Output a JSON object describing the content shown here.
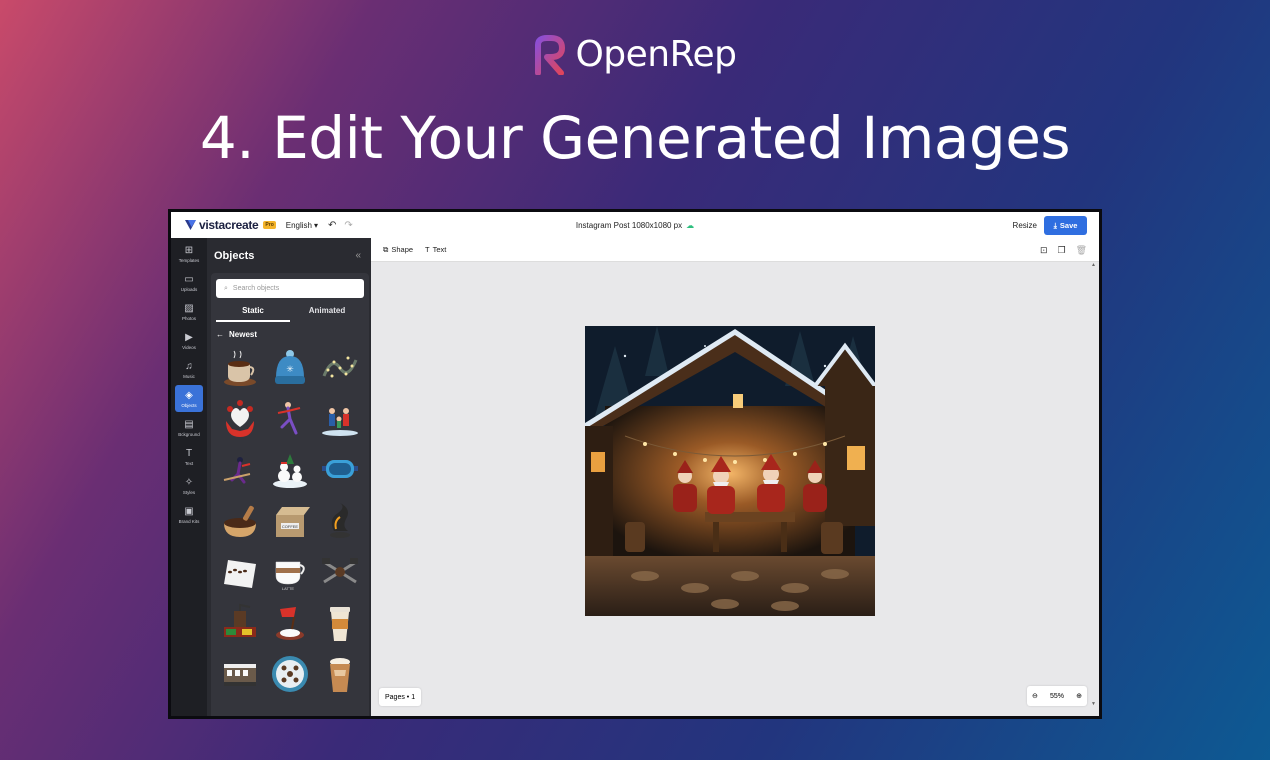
{
  "brand": {
    "name": "OpenRep",
    "logo_icon": "openrep-r-logo"
  },
  "headline": "4. Edit Your Generated Images",
  "app": {
    "logo": "vistacreate",
    "pro_badge": "Pro",
    "language": "English",
    "doc_title": "Instagram Post 1080x1080 px",
    "resize_label": "Resize",
    "save_label": "Save",
    "sidebar": [
      {
        "label": "Templates",
        "icon": "templates-icon"
      },
      {
        "label": "Uploads",
        "icon": "folder-icon"
      },
      {
        "label": "Photos",
        "icon": "photo-icon"
      },
      {
        "label": "Videos",
        "icon": "video-icon"
      },
      {
        "label": "Music",
        "icon": "music-icon"
      },
      {
        "label": "Objects",
        "icon": "objects-icon",
        "active": true
      },
      {
        "label": "Bckground",
        "icon": "background-icon"
      },
      {
        "label": "Text",
        "icon": "text-icon"
      },
      {
        "label": "Styles",
        "icon": "styles-icon"
      },
      {
        "label": "Brand Kits",
        "icon": "briefcase-icon"
      }
    ],
    "panel": {
      "title": "Objects",
      "search_placeholder": "Search objects",
      "tabs": [
        "Static",
        "Animated"
      ],
      "active_tab": "Static",
      "crumb": "Newest"
    },
    "toolbar": {
      "shape_label": "Shape",
      "text_label": "Text"
    },
    "pages_label": "Pages • 1",
    "zoom_level": "55%",
    "colors": {
      "accent": "#2f6ee0",
      "sidebar_bg": "#1e1f24",
      "panel_bg": "#2a2b31",
      "canvas_bg": "#e8e8ea"
    }
  }
}
